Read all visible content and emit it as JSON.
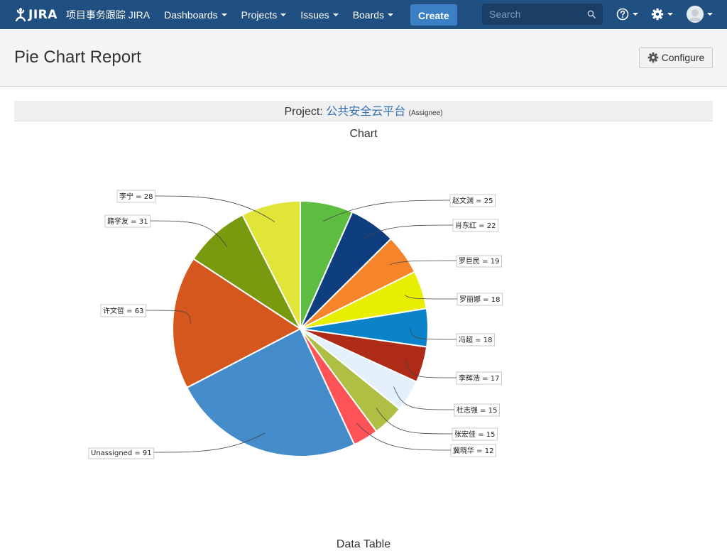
{
  "nav": {
    "logo_text": "JIRA",
    "site_title": "项目事务跟踪 JIRA",
    "items": [
      {
        "label": "Dashboards"
      },
      {
        "label": "Projects"
      },
      {
        "label": "Issues"
      },
      {
        "label": "Boards"
      }
    ],
    "create_label": "Create",
    "search_placeholder": "Search",
    "bar_color": "#205081",
    "create_color": "#3b7fc4"
  },
  "header": {
    "title": "Pie Chart Report",
    "configure_label": "Configure"
  },
  "report": {
    "project_prefix": "Project:",
    "project_name": "公共安全云平台",
    "statistic": "(Assignee)",
    "chart_heading": "Chart",
    "table_heading": "Data Table"
  },
  "chart_data": {
    "type": "pie",
    "title": "",
    "start_angle_deg": 0,
    "direction": "clockwise",
    "slices": [
      {
        "label": "赵文渊",
        "value": 25,
        "color": "#5cbd41"
      },
      {
        "label": "肖东红",
        "value": 22,
        "color": "#0f3e7f"
      },
      {
        "label": "罗巨民",
        "value": 19,
        "color": "#f5842b"
      },
      {
        "label": "罗丽娜",
        "value": 18,
        "color": "#e8ee00"
      },
      {
        "label": "冯超",
        "value": 18,
        "color": "#0c82c9"
      },
      {
        "label": "李辉浩",
        "value": 17,
        "color": "#ad2b17"
      },
      {
        "label": "杜志强",
        "value": 15,
        "color": "#e4f1fb"
      },
      {
        "label": "张宏佳",
        "value": 15,
        "color": "#aebf44"
      },
      {
        "label": "冀晓华",
        "value": 12,
        "color": "#fd5356"
      },
      {
        "label": "Unassigned",
        "value": 91,
        "color": "#448dca"
      },
      {
        "label": "许文哲",
        "value": 63,
        "color": "#d6571d"
      },
      {
        "label": "籍学友",
        "value": 31,
        "color": "#799a0e"
      },
      {
        "label": "李宁",
        "value": 28,
        "color": "#e0e537"
      }
    ]
  }
}
